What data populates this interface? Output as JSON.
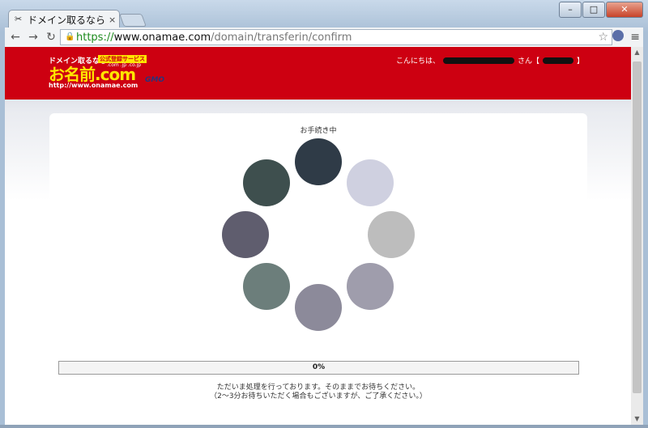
{
  "browser": {
    "tab_title": "ドメイン取るなら お",
    "tab_close": "×",
    "url_scheme": "https://",
    "url_host": "www.onamae.com",
    "url_path": "/domain/transferin/confirm",
    "lock_icon": "lock-icon",
    "window_buttons": {
      "minimize": "–",
      "maximize": "□",
      "close": "✕"
    },
    "nav": {
      "back": "←",
      "forward": "→",
      "reload": "↻",
      "star": "☆",
      "menu": "≡"
    }
  },
  "header": {
    "logo_tagline": "ドメイン取るなら",
    "logo_badge": "公式登録サービス",
    "logo_brand": "お名前.com",
    "logo_tlds": ".com  .jp  .co.jp",
    "logo_url": "http://www.onamae.com",
    "logo_gmo": "GMO",
    "greeting_prefix": "こんにちは、",
    "greeting_suffix": "さん【",
    "greeting_close": "】",
    "colors": {
      "bar": "#cd0011",
      "logo": "#ffe600"
    }
  },
  "card": {
    "status_text": "お手続き中",
    "progress_text": "0%",
    "progress_value": 0,
    "message_line1": "ただいま処理を行っております。そのままでお待ちください。",
    "message_line2": "（2～3分お待ちいただく場合もございますが、ご了承ください。）"
  },
  "spinner": {
    "dot_colors": [
      "#2f3b47",
      "#cfd0e0",
      "#bdbdbd",
      "#9f9dac",
      "#8c8a9a",
      "#6c7e7b",
      "#5f5d6e",
      "#3e4f4e"
    ]
  }
}
